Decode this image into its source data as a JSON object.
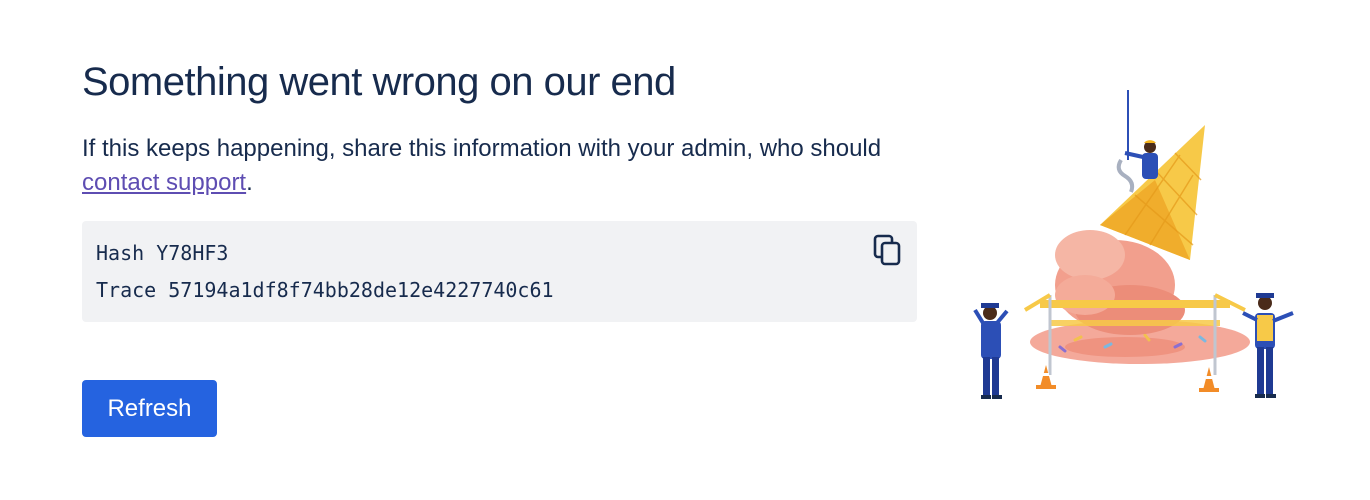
{
  "error": {
    "title": "Something went wrong on our end",
    "description_prefix": "If this keeps happening, share this information with your admin, who should ",
    "link_text": "contact support",
    "description_suffix": "."
  },
  "details": {
    "hash_line": "Hash Y78HF3",
    "trace_line": "Trace 57194a1df8f74bb28de12e4227740c61",
    "copy_icon": "copy-icon"
  },
  "actions": {
    "refresh_label": "Refresh"
  },
  "colors": {
    "heading": "#172b4d",
    "link": "#5e4db2",
    "box_bg": "#f1f2f4",
    "button_bg": "#2563e0"
  },
  "illustration": {
    "subject": "spilled-ice-cream-cone-with-workers"
  }
}
